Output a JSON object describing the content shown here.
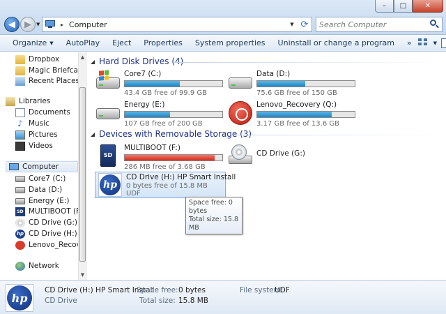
{
  "window": {
    "minimize": "–",
    "maximize": "□",
    "close": "✕"
  },
  "address": {
    "location": "Computer",
    "separator": "▸"
  },
  "search": {
    "placeholder": "Search Computer"
  },
  "commands": {
    "organize": "Organize",
    "autoplay": "AutoPlay",
    "eject": "Eject",
    "properties": "Properties",
    "system_properties": "System properties",
    "uninstall": "Uninstall or change a program",
    "more": "»"
  },
  "sidebar": {
    "items": [
      {
        "label": "Dropbox",
        "icon": "dropbox-icon"
      },
      {
        "label": "Magic Briefcase",
        "icon": "briefcase-icon"
      },
      {
        "label": "Recent Places",
        "icon": "recent-places-icon"
      },
      {
        "label": "Libraries",
        "icon": "libraries-icon"
      },
      {
        "label": "Documents",
        "icon": "documents-icon"
      },
      {
        "label": "Music",
        "icon": "music-icon"
      },
      {
        "label": "Pictures",
        "icon": "pictures-icon"
      },
      {
        "label": "Videos",
        "icon": "videos-icon"
      },
      {
        "label": "Computer",
        "icon": "computer-icon"
      },
      {
        "label": "Core7 (C:)",
        "icon": "windows-drive-icon"
      },
      {
        "label": "Data (D:)",
        "icon": "hard-drive-icon"
      },
      {
        "label": "Energy (E:)",
        "icon": "hard-drive-icon"
      },
      {
        "label": "MULTIBOOT (F:)",
        "icon": "sd-card-icon"
      },
      {
        "label": "CD Drive (G:)",
        "icon": "cd-drive-icon"
      },
      {
        "label": "CD Drive (H:) HP",
        "icon": "hp-icon"
      },
      {
        "label": "Lenovo_Recovery",
        "icon": "recovery-icon"
      },
      {
        "label": "Network",
        "icon": "network-icon"
      }
    ]
  },
  "groups": {
    "hard_disks": "Hard Disk Drives (4)",
    "removable": "Devices with Removable Storage (3)"
  },
  "drives": [
    {
      "name": "Core7 (C:)",
      "free_text": "43.4 GB free of 99.9 GB",
      "used_fraction": 0.566,
      "bar_color": "#1d86c8"
    },
    {
      "name": "Data (D:)",
      "free_text": "75.6 GB free of 150 GB",
      "used_fraction": 0.496,
      "bar_color": "#1d86c8"
    },
    {
      "name": "Energy (E:)",
      "free_text": "107 GB free of 200 GB",
      "used_fraction": 0.465,
      "bar_color": "#1d86c8"
    },
    {
      "name": "Lenovo_Recovery (Q:)",
      "free_text": "3.17 GB free of 13.6 GB",
      "used_fraction": 0.767,
      "bar_color": "#1d86c8"
    },
    {
      "name": "MULTIBOOT (F:)",
      "free_text": "286 MB free of 3.68 GB",
      "used_fraction": 0.924,
      "bar_color": "#d22a1a"
    }
  ],
  "cd_g": {
    "name": "CD Drive (G:)"
  },
  "cd_h": {
    "name": "CD Drive (H:) HP Smart Install",
    "free_text": "0 bytes free of 15.8 MB",
    "fs": "UDF"
  },
  "tooltip": {
    "line1": "Space free: 0 bytes",
    "line2": "Total size: 15.8 MB"
  },
  "details": {
    "title": "CD Drive (H:) HP Smart Install",
    "type": "CD Drive",
    "space_free_label": "Space free:",
    "space_free_value": "0 bytes",
    "total_size_label": "Total size:",
    "total_size_value": "15.8 MB",
    "fs_label": "File system:",
    "fs_value": "UDF"
  },
  "logo_text": "hp",
  "icons": {
    "view": "view-options-icon",
    "preview": "preview-pane-icon",
    "help": "?"
  }
}
